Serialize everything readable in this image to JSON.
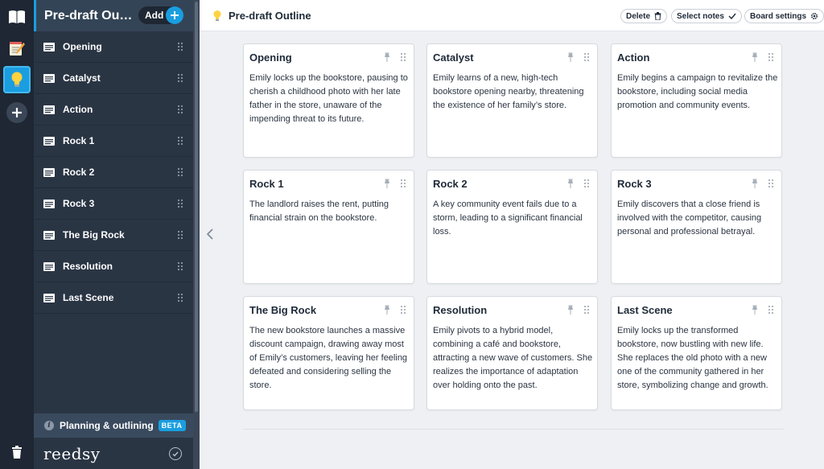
{
  "app": {
    "board_title": "Pre-draft Outline",
    "sidebar_title": "Pre-draft Ou…",
    "add_label": "Add",
    "accent_color": "#1a9ee0"
  },
  "rail": {
    "icons": [
      "book-icon",
      "notepad-icon",
      "lightbulb-icon",
      "plus-icon",
      "trash-icon"
    ]
  },
  "sidebar": {
    "items": [
      {
        "label": "Opening"
      },
      {
        "label": "Catalyst"
      },
      {
        "label": "Action"
      },
      {
        "label": "Rock 1"
      },
      {
        "label": "Rock 2"
      },
      {
        "label": "Rock 3"
      },
      {
        "label": "The Big Rock"
      },
      {
        "label": "Resolution"
      },
      {
        "label": "Last Scene"
      }
    ],
    "footer_plan_label": "Planning & outlining",
    "beta_label": "BETA",
    "brand": "reedsy"
  },
  "toolbar": {
    "delete_label": "Delete",
    "select_notes_label": "Select notes",
    "board_settings_label": "Board settings"
  },
  "cards": [
    {
      "title": "Opening",
      "body": "Emily locks up the bookstore, pausing to cherish a childhood photo with her late father in the store, unaware of the impending threat to its future."
    },
    {
      "title": "Catalyst",
      "body": "Emily learns of a new, high-tech bookstore opening nearby, threatening the existence of her family’s store."
    },
    {
      "title": "Action",
      "body": "Emily begins a campaign to revitalize the bookstore, including social media promotion and community events."
    },
    {
      "title": "Rock 1",
      "body": "The landlord raises the rent, putting financial strain on the bookstore."
    },
    {
      "title": "Rock 2",
      "body": "A key community event fails due to a storm, leading to a significant financial loss."
    },
    {
      "title": "Rock 3",
      "body": "Emily discovers that a close friend is involved with the competitor, causing personal and professional betrayal."
    },
    {
      "title": "The Big Rock",
      "body": "The new bookstore launches a massive discount campaign, drawing away most of Emily’s customers, leaving her feeling defeated and considering selling the store."
    },
    {
      "title": "Resolution",
      "body": "Emily pivots to a hybrid model, combining a café and bookstore, attracting a new wave of customers. She realizes the importance of adaptation over holding onto the past."
    },
    {
      "title": "Last Scene",
      "body": "Emily locks up the transformed bookstore, now bustling with new life. She replaces the old photo with a new one of the community gathered in her store, symbolizing change and growth."
    }
  ]
}
